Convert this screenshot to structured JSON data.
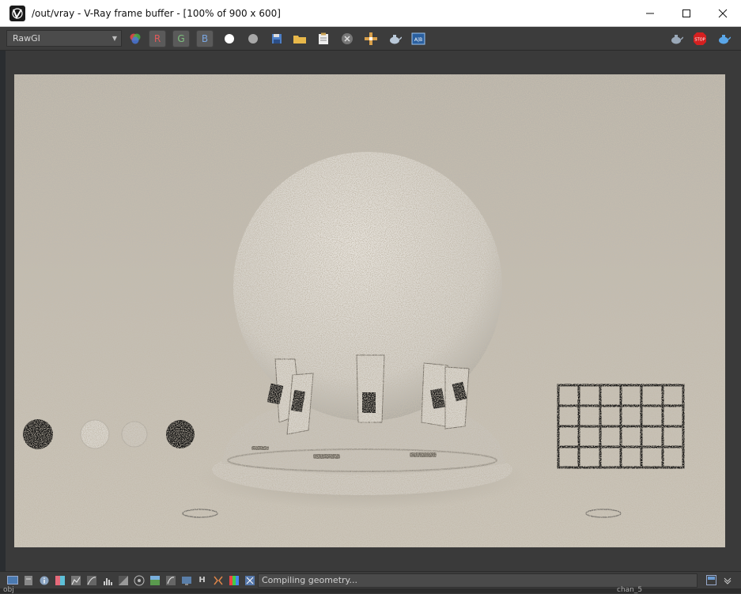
{
  "window": {
    "title": "/out/vray - V-Ray frame buffer - [100% of 900 x 600]",
    "controls": [
      "minimize",
      "maximize",
      "close"
    ]
  },
  "toolbar": {
    "channel": "RawGI",
    "red_label": "R",
    "green_label": "G",
    "blue_label": "B"
  },
  "status": {
    "message": "Compiling geometry..."
  },
  "status_icons": {
    "h_label": "H"
  },
  "background": {
    "left_label": "obj",
    "right_label": "chan_5"
  },
  "colors": {
    "accent_red": "#c44",
    "accent_blue": "#3a7fc4",
    "stop": "#d42020"
  }
}
